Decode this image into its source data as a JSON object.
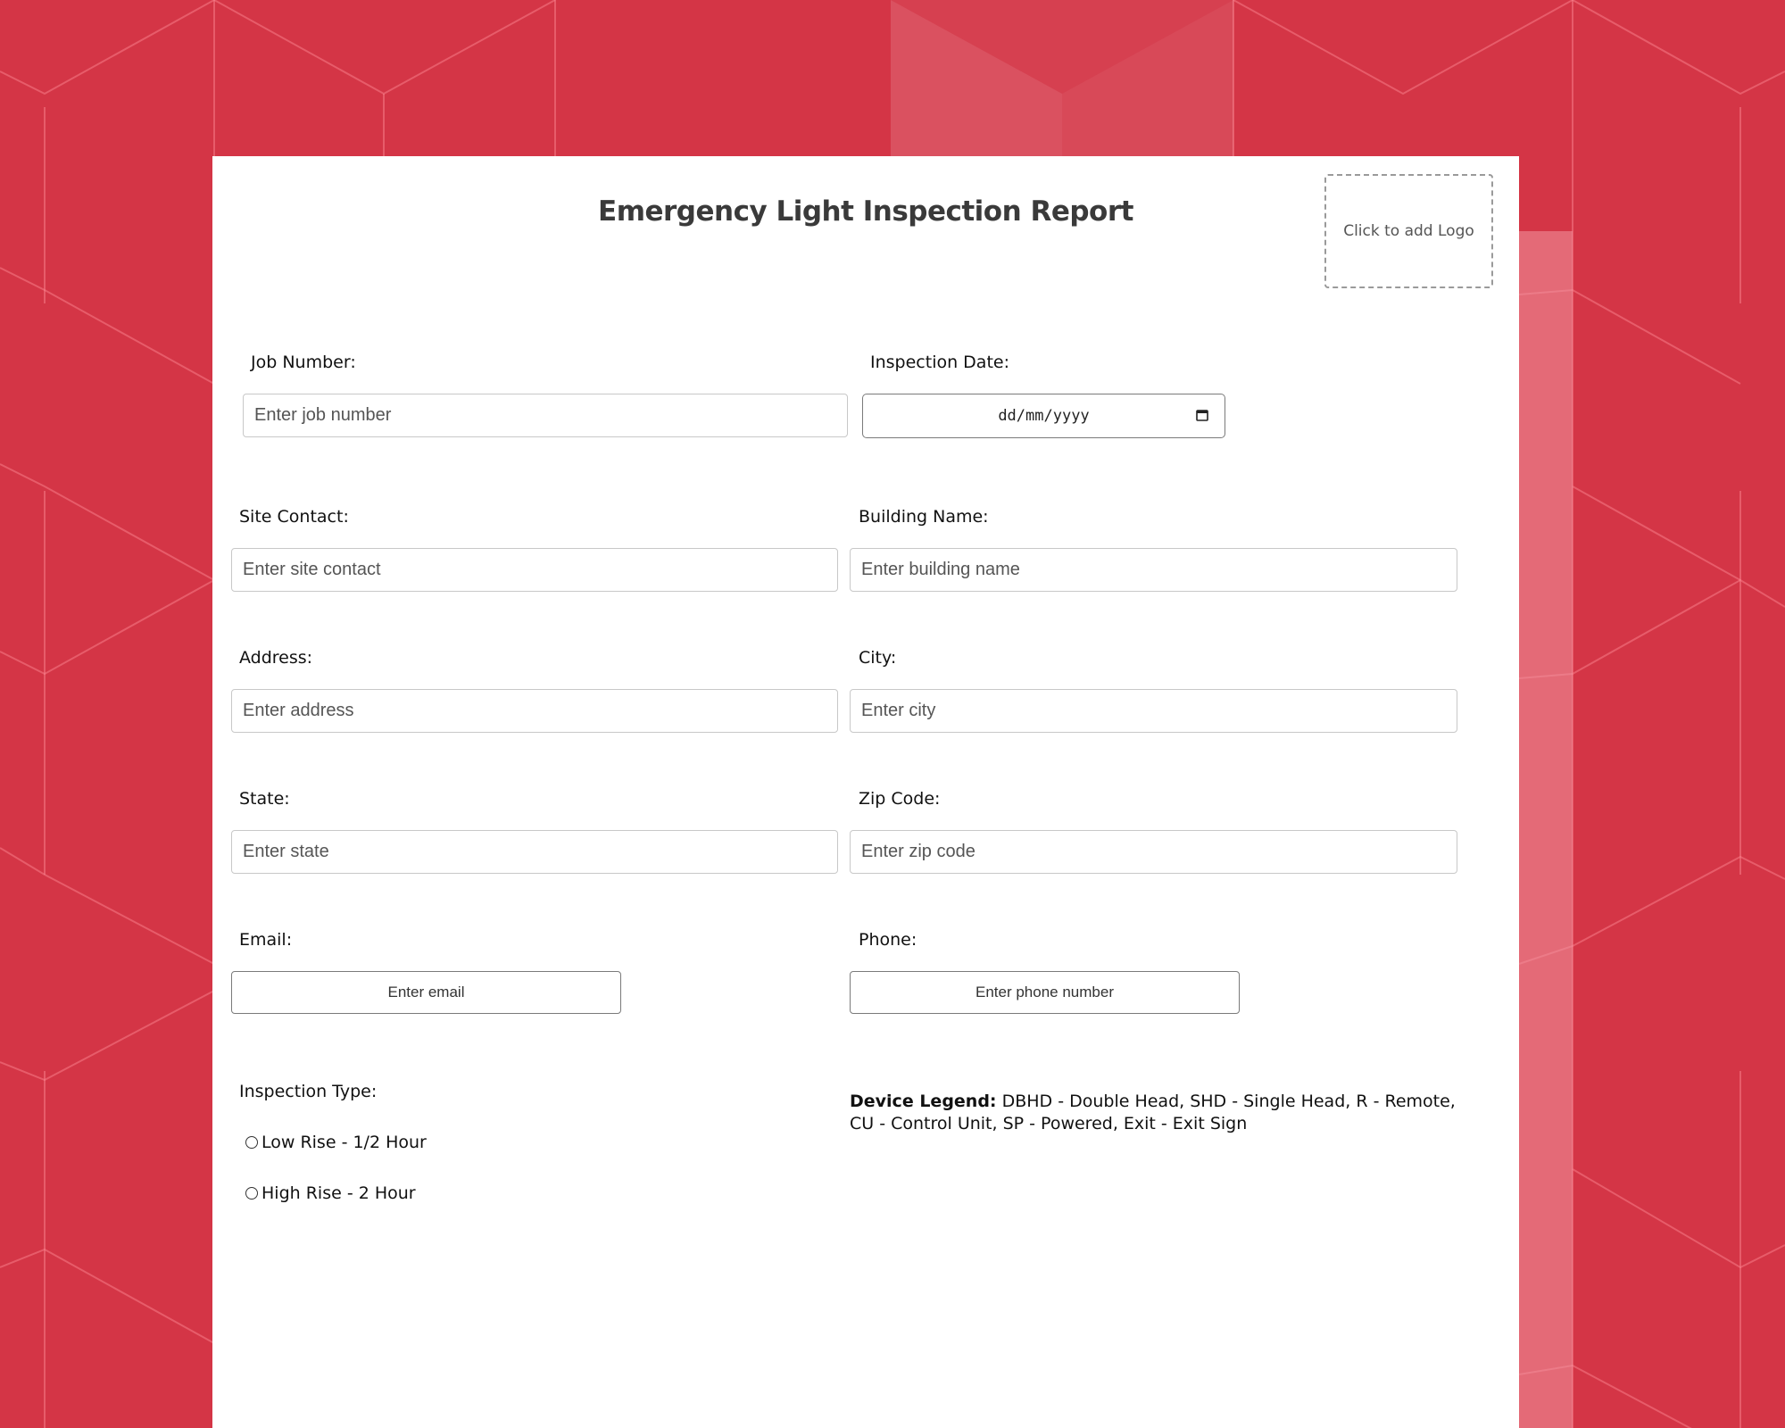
{
  "form": {
    "title": "Emergency Light Inspection Report",
    "logo_placeholder": "Click to add Logo",
    "fields": {
      "job_number": {
        "label": "Job Number:",
        "placeholder": "Enter job number"
      },
      "inspection_date": {
        "label": "Inspection Date:",
        "placeholder": "dd/mm/yyyy"
      },
      "site_contact": {
        "label": "Site Contact:",
        "placeholder": "Enter site contact"
      },
      "building_name": {
        "label": "Building Name:",
        "placeholder": "Enter building name"
      },
      "address": {
        "label": "Address:",
        "placeholder": "Enter address"
      },
      "city": {
        "label": "City:",
        "placeholder": "Enter city"
      },
      "state": {
        "label": "State:",
        "placeholder": "Enter state"
      },
      "zip_code": {
        "label": "Zip Code:",
        "placeholder": "Enter zip code"
      },
      "email": {
        "label": "Email:",
        "placeholder": "Enter email"
      },
      "phone": {
        "label": "Phone:",
        "placeholder": "Enter phone number"
      }
    },
    "inspection_type": {
      "label": "Inspection Type:",
      "options": [
        {
          "label": "Low Rise - 1/2 Hour",
          "selected": false
        },
        {
          "label": "High Rise - 2 Hour",
          "selected": false
        }
      ]
    },
    "device_legend": {
      "heading": "Device Legend:",
      "text": " DBHD - Double Head, SHD - Single Head, R - Remote, CU - Control Unit, SP - Powered, Exit - Exit Sign"
    }
  },
  "colors": {
    "background": "#d43546",
    "card": "#ffffff",
    "title": "#3a3a3a"
  }
}
